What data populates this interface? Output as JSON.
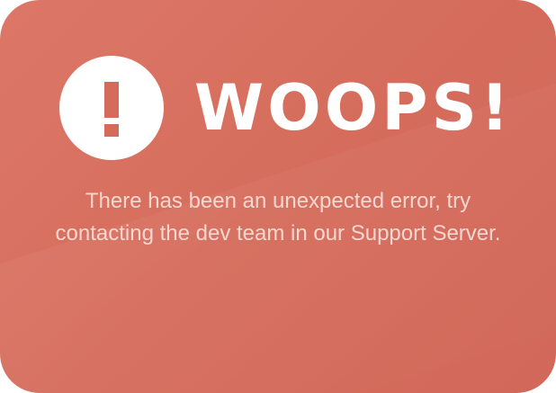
{
  "error_card": {
    "title": "WOOPS!",
    "message_line1": "There has been an unexpected error, try",
    "message_line2": "contacting the dev team in our Support Server.",
    "icon": "exclamation-circle-icon"
  },
  "colors": {
    "card_background": "#d56c5b",
    "icon_background": "#ffffff",
    "title_text": "#ffffff",
    "message_text": "#f7d7d0"
  }
}
